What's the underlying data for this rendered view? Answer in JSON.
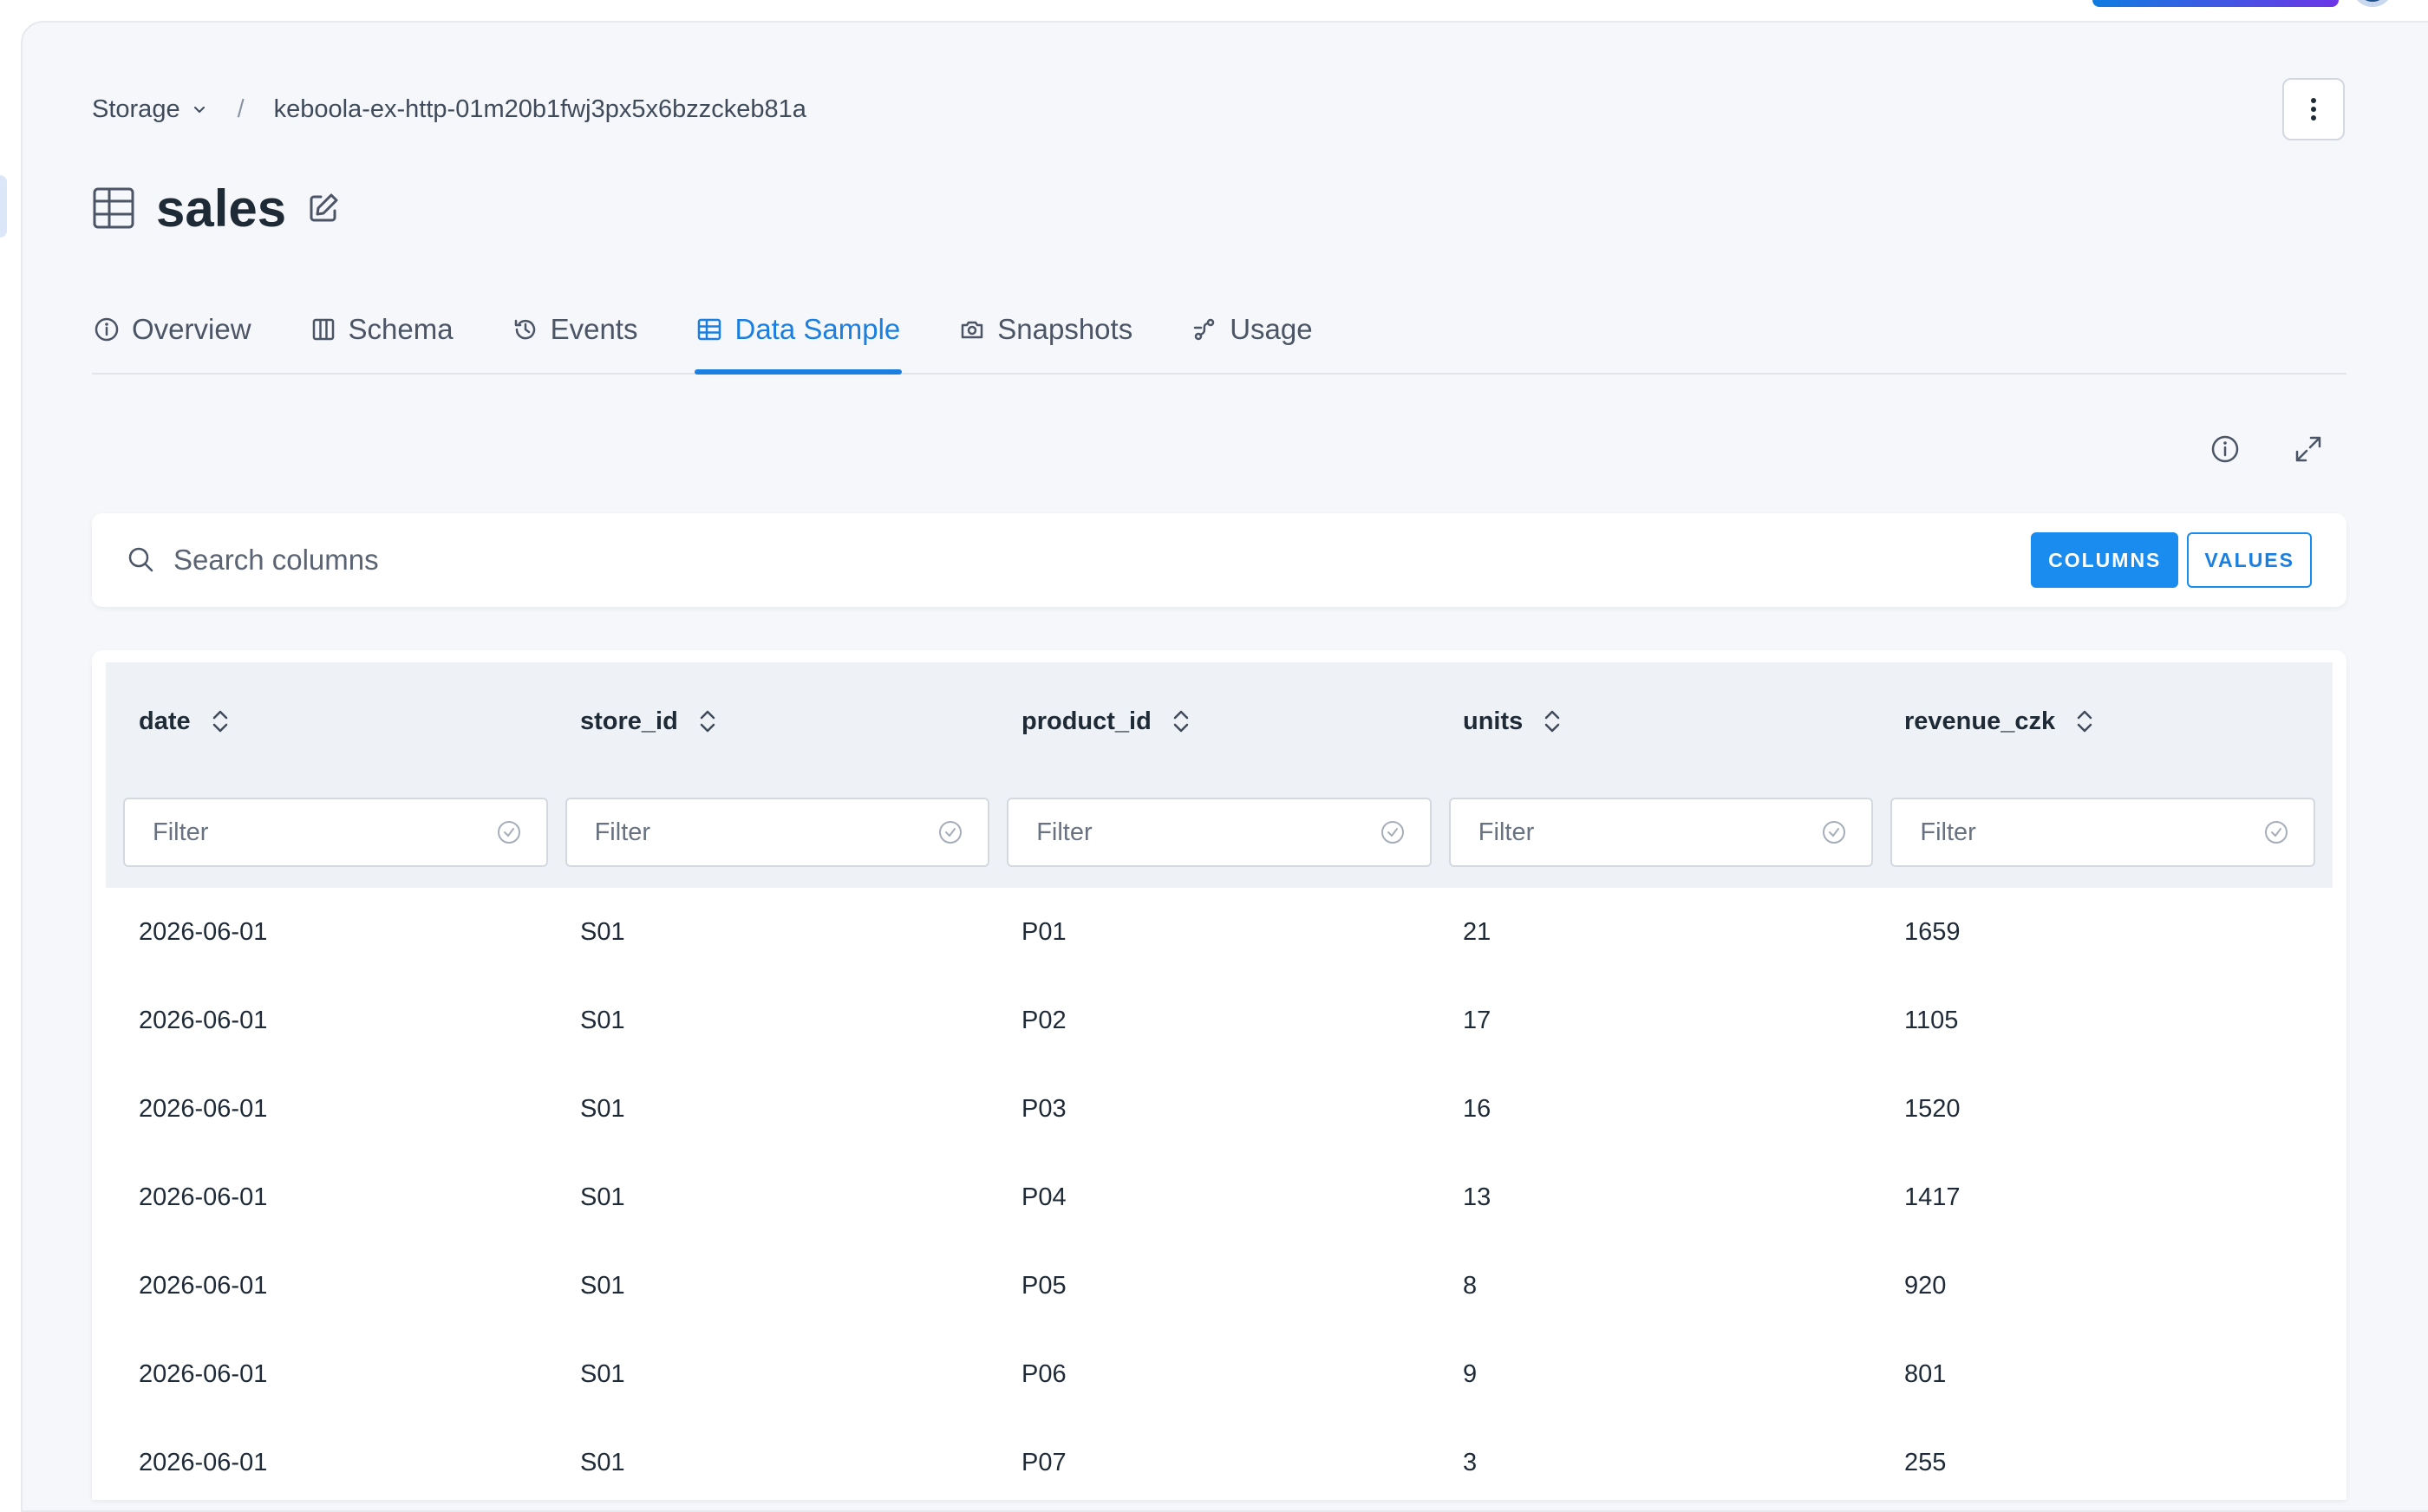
{
  "breadcrumb": {
    "root": "Storage",
    "separator": "/",
    "bucket": "keboola-ex-http-01m20b1fwj3px5x6bzzckeb81a"
  },
  "page": {
    "title": "sales"
  },
  "tabs": [
    {
      "label": "Overview",
      "icon": "info-icon",
      "active": false
    },
    {
      "label": "Schema",
      "icon": "columns-icon",
      "active": false
    },
    {
      "label": "Events",
      "icon": "history-icon",
      "active": false
    },
    {
      "label": "Data Sample",
      "icon": "table-icon",
      "active": true
    },
    {
      "label": "Snapshots",
      "icon": "camera-icon",
      "active": false
    },
    {
      "label": "Usage",
      "icon": "lineage-icon",
      "active": false
    }
  ],
  "search": {
    "placeholder": "Search columns",
    "mode_columns": "COLUMNS",
    "mode_values": "VALUES"
  },
  "table": {
    "filter_placeholder": "Filter",
    "columns": [
      "date",
      "store_id",
      "product_id",
      "units",
      "revenue_czk"
    ],
    "rows": [
      [
        "2026-06-01",
        "S01",
        "P01",
        "21",
        "1659"
      ],
      [
        "2026-06-01",
        "S01",
        "P02",
        "17",
        "1105"
      ],
      [
        "2026-06-01",
        "S01",
        "P03",
        "16",
        "1520"
      ],
      [
        "2026-06-01",
        "S01",
        "P04",
        "13",
        "1417"
      ],
      [
        "2026-06-01",
        "S01",
        "P05",
        "8",
        "920"
      ],
      [
        "2026-06-01",
        "S01",
        "P06",
        "9",
        "801"
      ],
      [
        "2026-06-01",
        "S01",
        "P07",
        "3",
        "255"
      ]
    ]
  },
  "colors": {
    "accent": "#1a7fe0",
    "panel_bg": "#f5f7fa",
    "header_bg": "#eef1f6"
  }
}
